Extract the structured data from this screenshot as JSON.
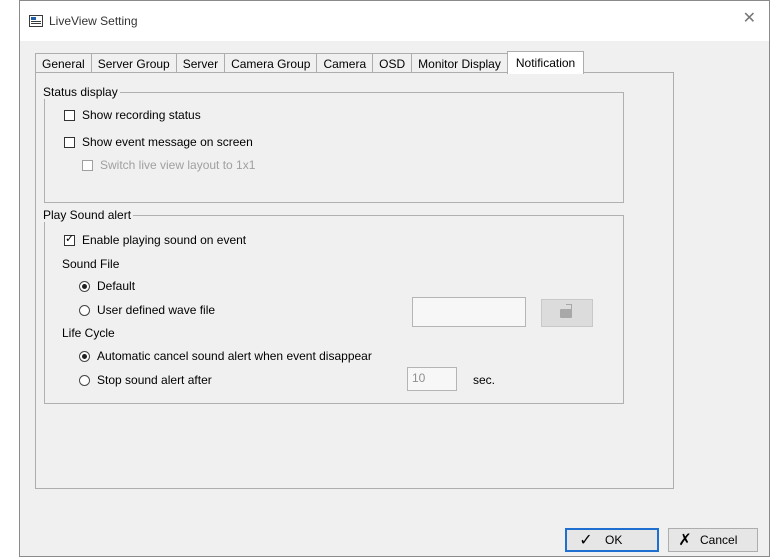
{
  "window": {
    "title": "LiveView Setting"
  },
  "tabs": [
    {
      "label": "General"
    },
    {
      "label": "Server Group"
    },
    {
      "label": "Server"
    },
    {
      "label": "Camera Group"
    },
    {
      "label": "Camera"
    },
    {
      "label": "OSD"
    },
    {
      "label": "Monitor Display"
    },
    {
      "label": "Notification",
      "active": true
    }
  ],
  "status_display": {
    "legend": "Status display",
    "show_recording": {
      "label": "Show recording status",
      "checked": false
    },
    "show_event_message": {
      "label": "Show event message on screen",
      "checked": false
    },
    "switch_layout": {
      "label": "Switch live view layout to 1x1",
      "checked": false,
      "enabled": false
    }
  },
  "sound_alert": {
    "legend": "Play Sound alert",
    "enable": {
      "label": "Enable playing sound on event",
      "checked": true
    },
    "sound_file_label": "Sound File",
    "default_option": {
      "label": "Default",
      "selected": true
    },
    "user_wave_option": {
      "label": "User defined wave file",
      "selected": false
    },
    "wave_file_value": "",
    "life_cycle_label": "Life Cycle",
    "auto_cancel_option": {
      "label": "Automatic cancel sound alert when event disappear",
      "selected": true
    },
    "stop_after_option": {
      "label": "Stop sound alert after",
      "selected": false
    },
    "stop_after_value": "10",
    "stop_after_unit": "sec."
  },
  "buttons": {
    "ok": {
      "label": "OK",
      "icon": "check-icon"
    },
    "cancel": {
      "label": "Cancel",
      "icon": "x-icon"
    }
  }
}
